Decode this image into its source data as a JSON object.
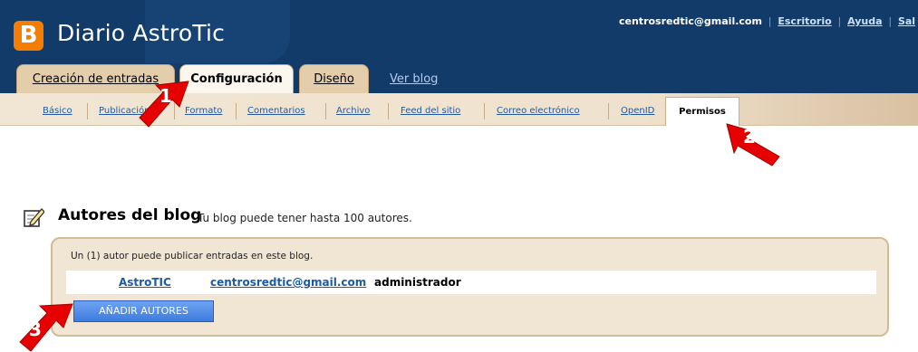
{
  "header": {
    "blog_title": "Diario AstroTic",
    "account_email": "centrosredtic@gmail.com",
    "links": [
      "Escritorio",
      "Ayuda",
      "Sal"
    ]
  },
  "tabs": [
    "Creación de entradas",
    "Configuración",
    "Diseño"
  ],
  "view_blog_label": "Ver blog",
  "subnav": {
    "items": [
      "Básico",
      "Publicación",
      "Formato",
      "Comentarios",
      "Archivo",
      "Feed del sitio",
      "Correo electrónico",
      "OpenID"
    ],
    "active": "Permisos"
  },
  "section": {
    "title": "Autores del blog",
    "description": "Tu blog puede tener hasta 100 autores."
  },
  "panel": {
    "summary": "Un (1) autor puede publicar entradas en este blog.",
    "author": {
      "name": "AstroTIC",
      "email": "centrosredtic@gmail.com",
      "role": "administrador"
    },
    "add_button": "AÑADIR AUTORES"
  },
  "callouts": [
    "1",
    "2",
    "3"
  ],
  "colors": {
    "header_bg": "#123b69",
    "tab_bg": "#e4cdaa",
    "subnav_bg": "#f1e6d4",
    "link": "#1f5aa5",
    "button": "#4c87e6",
    "callout_red": "#e60000"
  }
}
